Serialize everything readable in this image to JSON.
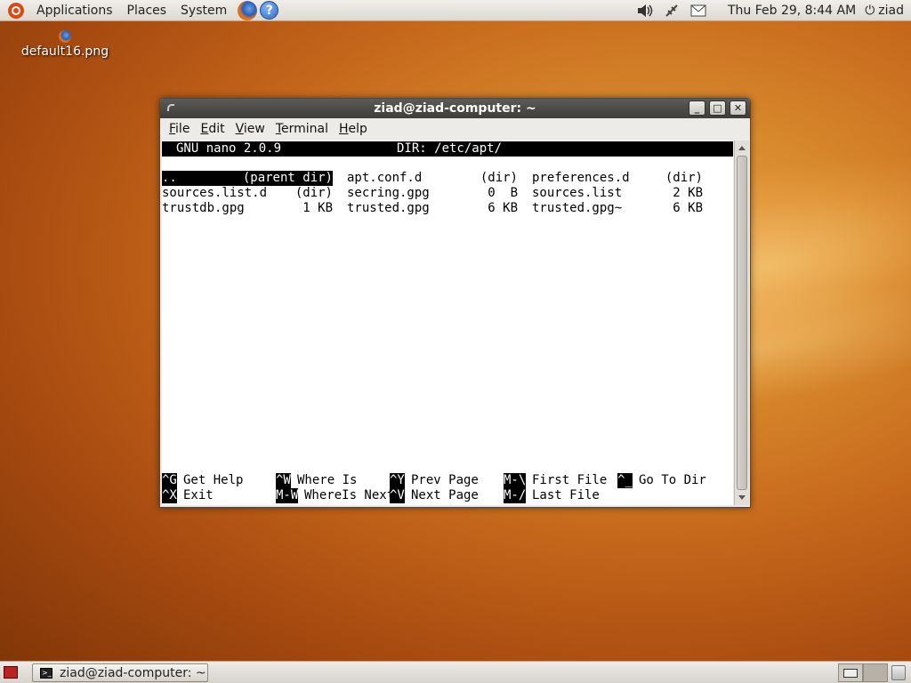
{
  "top_panel": {
    "menus": [
      "Applications",
      "Places",
      "System"
    ],
    "clock": "Thu Feb 29,  8:44 AM",
    "user": "ziad"
  },
  "desktop": {
    "icon_label": "default16.png"
  },
  "window": {
    "title": "ziad@ziad-computer: ~",
    "menubar": [
      {
        "mnemonic": "F",
        "rest": "ile"
      },
      {
        "mnemonic": "E",
        "rest": "dit"
      },
      {
        "mnemonic": "V",
        "rest": "iew"
      },
      {
        "mnemonic": "T",
        "rest": "erminal"
      },
      {
        "mnemonic": "H",
        "rest": "elp"
      }
    ]
  },
  "nano": {
    "version": "GNU nano 2.0.9",
    "dir": "DIR: /etc/apt/",
    "entries": [
      {
        "name": "..",
        "size": "(parent dir)",
        "selected": true
      },
      {
        "name": "apt.conf.d",
        "size": "(dir)"
      },
      {
        "name": "preferences.d",
        "size": "(dir)"
      },
      {
        "name": "sources.list.d",
        "size": "(dir)"
      },
      {
        "name": "secring.gpg",
        "size": "0  B"
      },
      {
        "name": "sources.list",
        "size": "2 KB"
      },
      {
        "name": "trustdb.gpg",
        "size": "1 KB"
      },
      {
        "name": "trusted.gpg",
        "size": "6 KB"
      },
      {
        "name": "trusted.gpg~",
        "size": "6 KB"
      }
    ],
    "shortcuts_row1": [
      {
        "key": "^G",
        "label": "Get Help"
      },
      {
        "key": "^W",
        "label": "Where Is"
      },
      {
        "key": "^Y",
        "label": "Prev Page"
      },
      {
        "key": "M-\\",
        "label": "First File"
      },
      {
        "key": "^_",
        "label": "Go To Dir"
      }
    ],
    "shortcuts_row2": [
      {
        "key": "^X",
        "label": "Exit"
      },
      {
        "key": "M-W",
        "label": "WhereIs Next"
      },
      {
        "key": "^V",
        "label": "Next Page"
      },
      {
        "key": "M-/",
        "label": "Last File"
      }
    ]
  },
  "taskbar": {
    "task_label": "ziad@ziad-computer: ~"
  }
}
